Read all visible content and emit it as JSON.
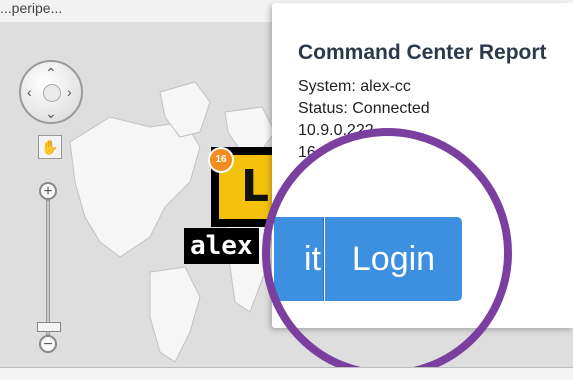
{
  "top": {
    "text": "...peripe..."
  },
  "map_controls": {
    "pan_up": "⌃",
    "pan_down": "⌄",
    "pan_left": "‹",
    "pan_right": "›",
    "zoom_in": "+",
    "zoom_out": "−",
    "hand_icon": "hand-icon"
  },
  "marker": {
    "badge_count": "16",
    "letter": "L",
    "label": "alex"
  },
  "popup": {
    "title": "Command Center Report",
    "system": "System: alex-cc",
    "status": "Status: Connected",
    "ip": "10.9.0.222",
    "extra": "16"
  },
  "buttons": {
    "edit_label": "it",
    "login_label": "Login"
  },
  "colors": {
    "button_blue": "#3d8fe0",
    "highlight_circle": "#7b3f9f",
    "badge_orange": "#f28c1e",
    "marker_yellow": "#f4c20d"
  }
}
